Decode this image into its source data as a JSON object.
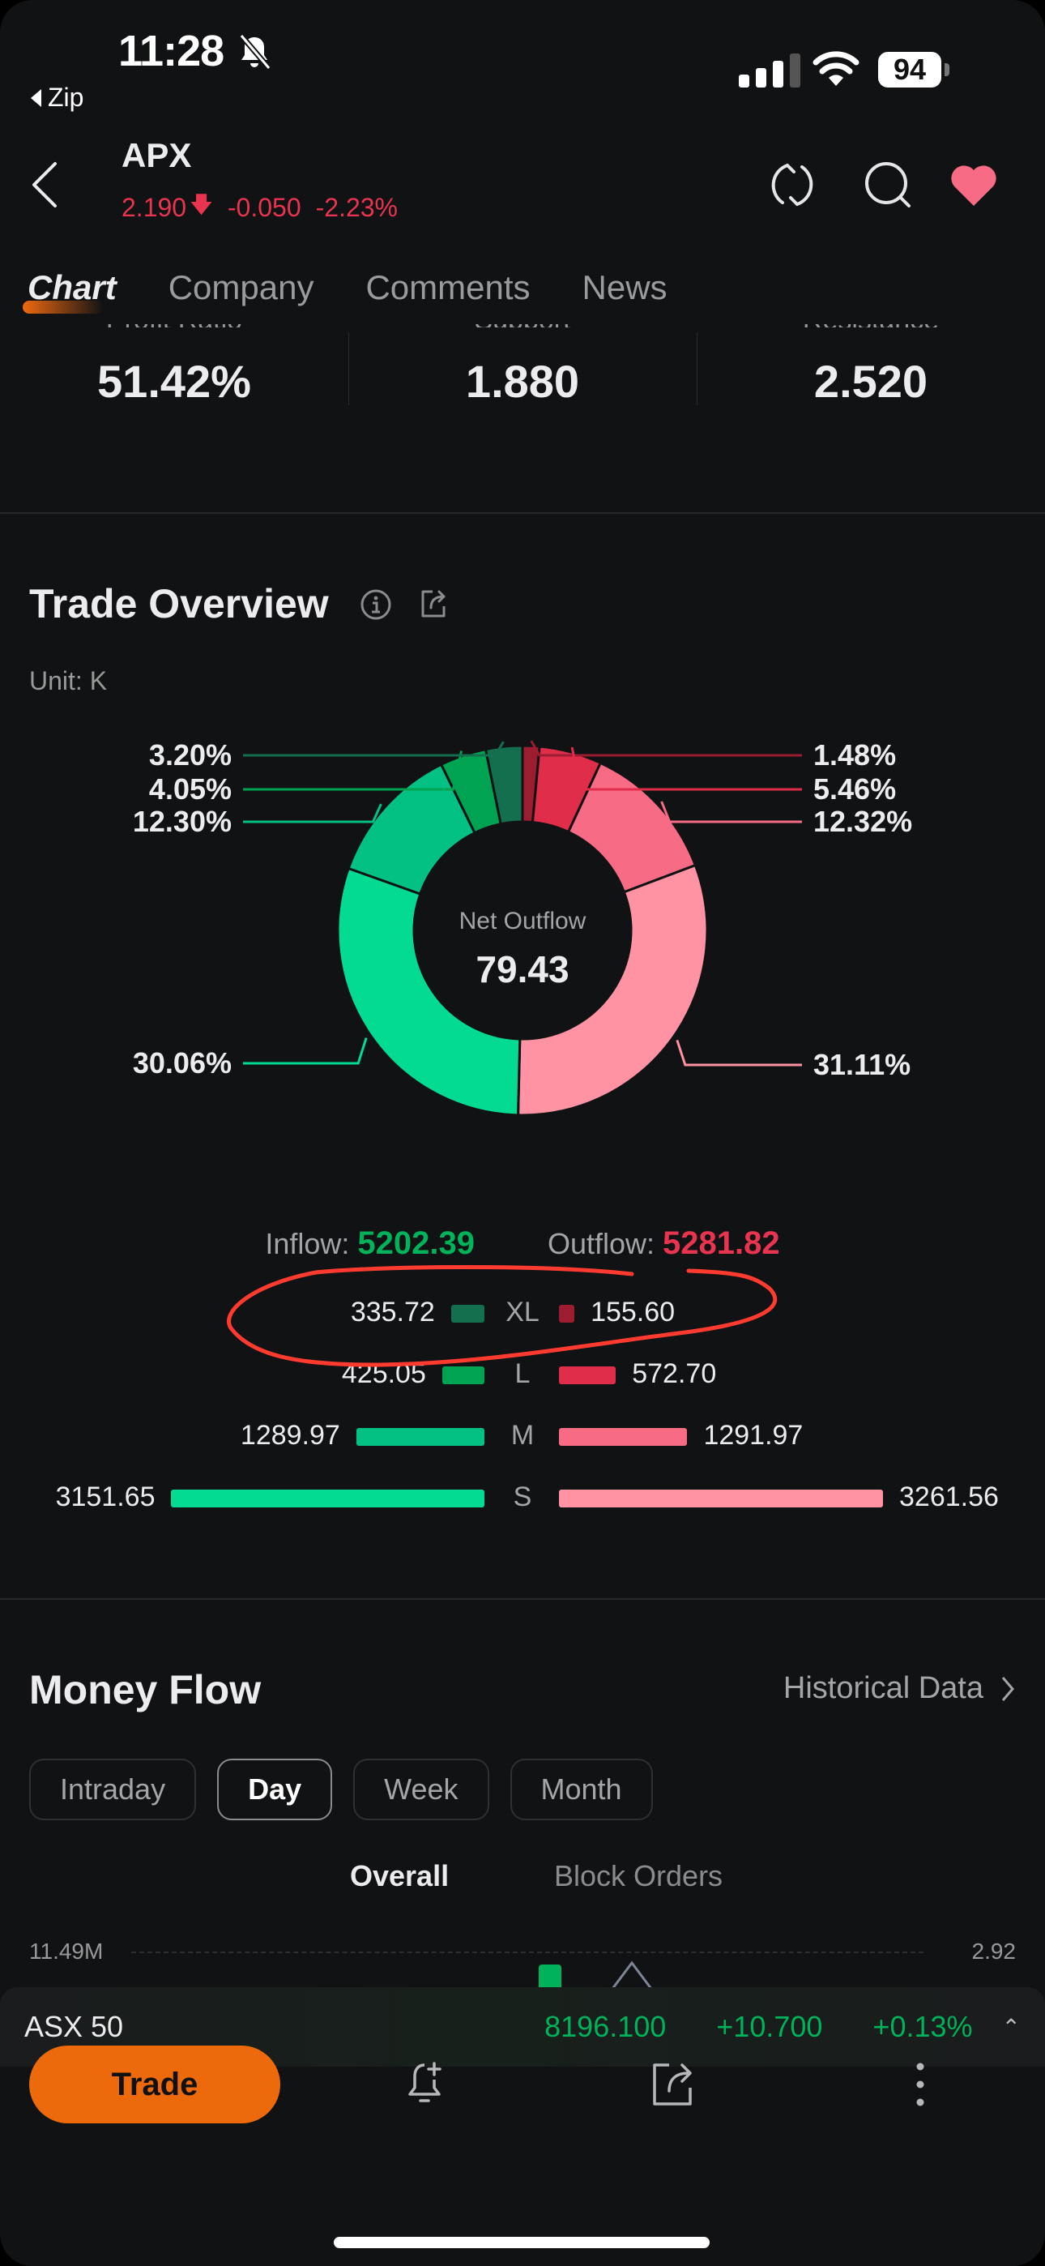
{
  "status_bar": {
    "time": "11:28",
    "back_app": "Zip",
    "battery": "94",
    "signal_bars_on": 3,
    "signal_bars_total": 4,
    "icons": [
      "bell-off-icon",
      "signal-icon",
      "wifi-icon",
      "battery-icon"
    ]
  },
  "header": {
    "symbol": "APX",
    "price": "2.190",
    "change": "-0.050",
    "change_pct": "-2.23%",
    "direction_icon": "arrow-down-icon",
    "icons": [
      "back-icon",
      "refresh-icon",
      "search-icon",
      "heart-icon"
    ],
    "favorite_color": "#f76b84",
    "down_color": "#e8344e"
  },
  "tabs": [
    {
      "label": "Chart",
      "active": true
    },
    {
      "label": "Company",
      "active": false
    },
    {
      "label": "Comments",
      "active": false
    },
    {
      "label": "News",
      "active": false
    }
  ],
  "stats": [
    {
      "label": "Profit Ratio",
      "value": "51.42%"
    },
    {
      "label": "Support",
      "value": "1.880"
    },
    {
      "label": "Resistance",
      "value": "2.520"
    }
  ],
  "trade_overview": {
    "title": "Trade Overview",
    "unit": "Unit: K",
    "center_label": "Net Outflow",
    "center_value": "79.43",
    "inflow_label": "Inflow:",
    "inflow_value": "5202.39",
    "outflow_label": "Outflow:",
    "outflow_value": "5281.82",
    "rows": [
      {
        "cat": "XL",
        "inflow": "335.72",
        "outflow": "155.60",
        "in_color": "#136f4e",
        "out_color": "#9c1c30"
      },
      {
        "cat": "L",
        "inflow": "425.05",
        "outflow": "572.70",
        "in_color": "#00a352",
        "out_color": "#e02d4a"
      },
      {
        "cat": "M",
        "inflow": "1289.97",
        "outflow": "1291.97",
        "in_color": "#02c182",
        "out_color": "#f76b84"
      },
      {
        "cat": "S",
        "inflow": "3151.65",
        "outflow": "3261.56",
        "in_color": "#03db92",
        "out_color": "#ff93a3"
      }
    ],
    "annotation": "red hand-drawn circle around XL row"
  },
  "chart_data": {
    "type": "pie",
    "title": "Trade Overview",
    "subtitle": "Unit: K",
    "center_text": "Net Outflow 79.43",
    "slices": [
      {
        "name": "Outflow XL",
        "value": 1.48,
        "label": "1.48%",
        "color": "#9c1c30"
      },
      {
        "name": "Outflow L",
        "value": 5.46,
        "label": "5.46%",
        "color": "#e02d4a"
      },
      {
        "name": "Outflow M",
        "value": 12.32,
        "label": "12.32%",
        "color": "#f76b84"
      },
      {
        "name": "Outflow S",
        "value": 31.11,
        "label": "31.11%",
        "color": "#ff93a3"
      },
      {
        "name": "Inflow S",
        "value": 30.06,
        "label": "30.06%",
        "color": "#03db92"
      },
      {
        "name": "Inflow M",
        "value": 12.3,
        "label": "12.30%",
        "color": "#02c182"
      },
      {
        "name": "Inflow L",
        "value": 4.05,
        "label": "4.05%",
        "color": "#00a352"
      },
      {
        "name": "Inflow XL",
        "value": 3.2,
        "label": "3.20%",
        "color": "#136f4e"
      }
    ]
  },
  "money_flow": {
    "title": "Money Flow",
    "historical_link": "Historical Data",
    "periods": [
      {
        "label": "Intraday",
        "active": false
      },
      {
        "label": "Day",
        "active": true
      },
      {
        "label": "Week",
        "active": false
      },
      {
        "label": "Month",
        "active": false
      }
    ],
    "subtabs": [
      {
        "label": "Overall",
        "active": true
      },
      {
        "label": "Block Orders",
        "active": false
      }
    ],
    "axis_left_top": "11.49M",
    "axis_right_top": "2.92"
  },
  "ticker": {
    "name": "ASX 50",
    "value": "8196.100",
    "change": "+10.700",
    "change_pct": "+0.13%",
    "up_color": "#00b259"
  },
  "action_bar": {
    "trade_label": "Trade",
    "icons": [
      "alert-add-icon",
      "share-icon",
      "more-icon"
    ]
  }
}
